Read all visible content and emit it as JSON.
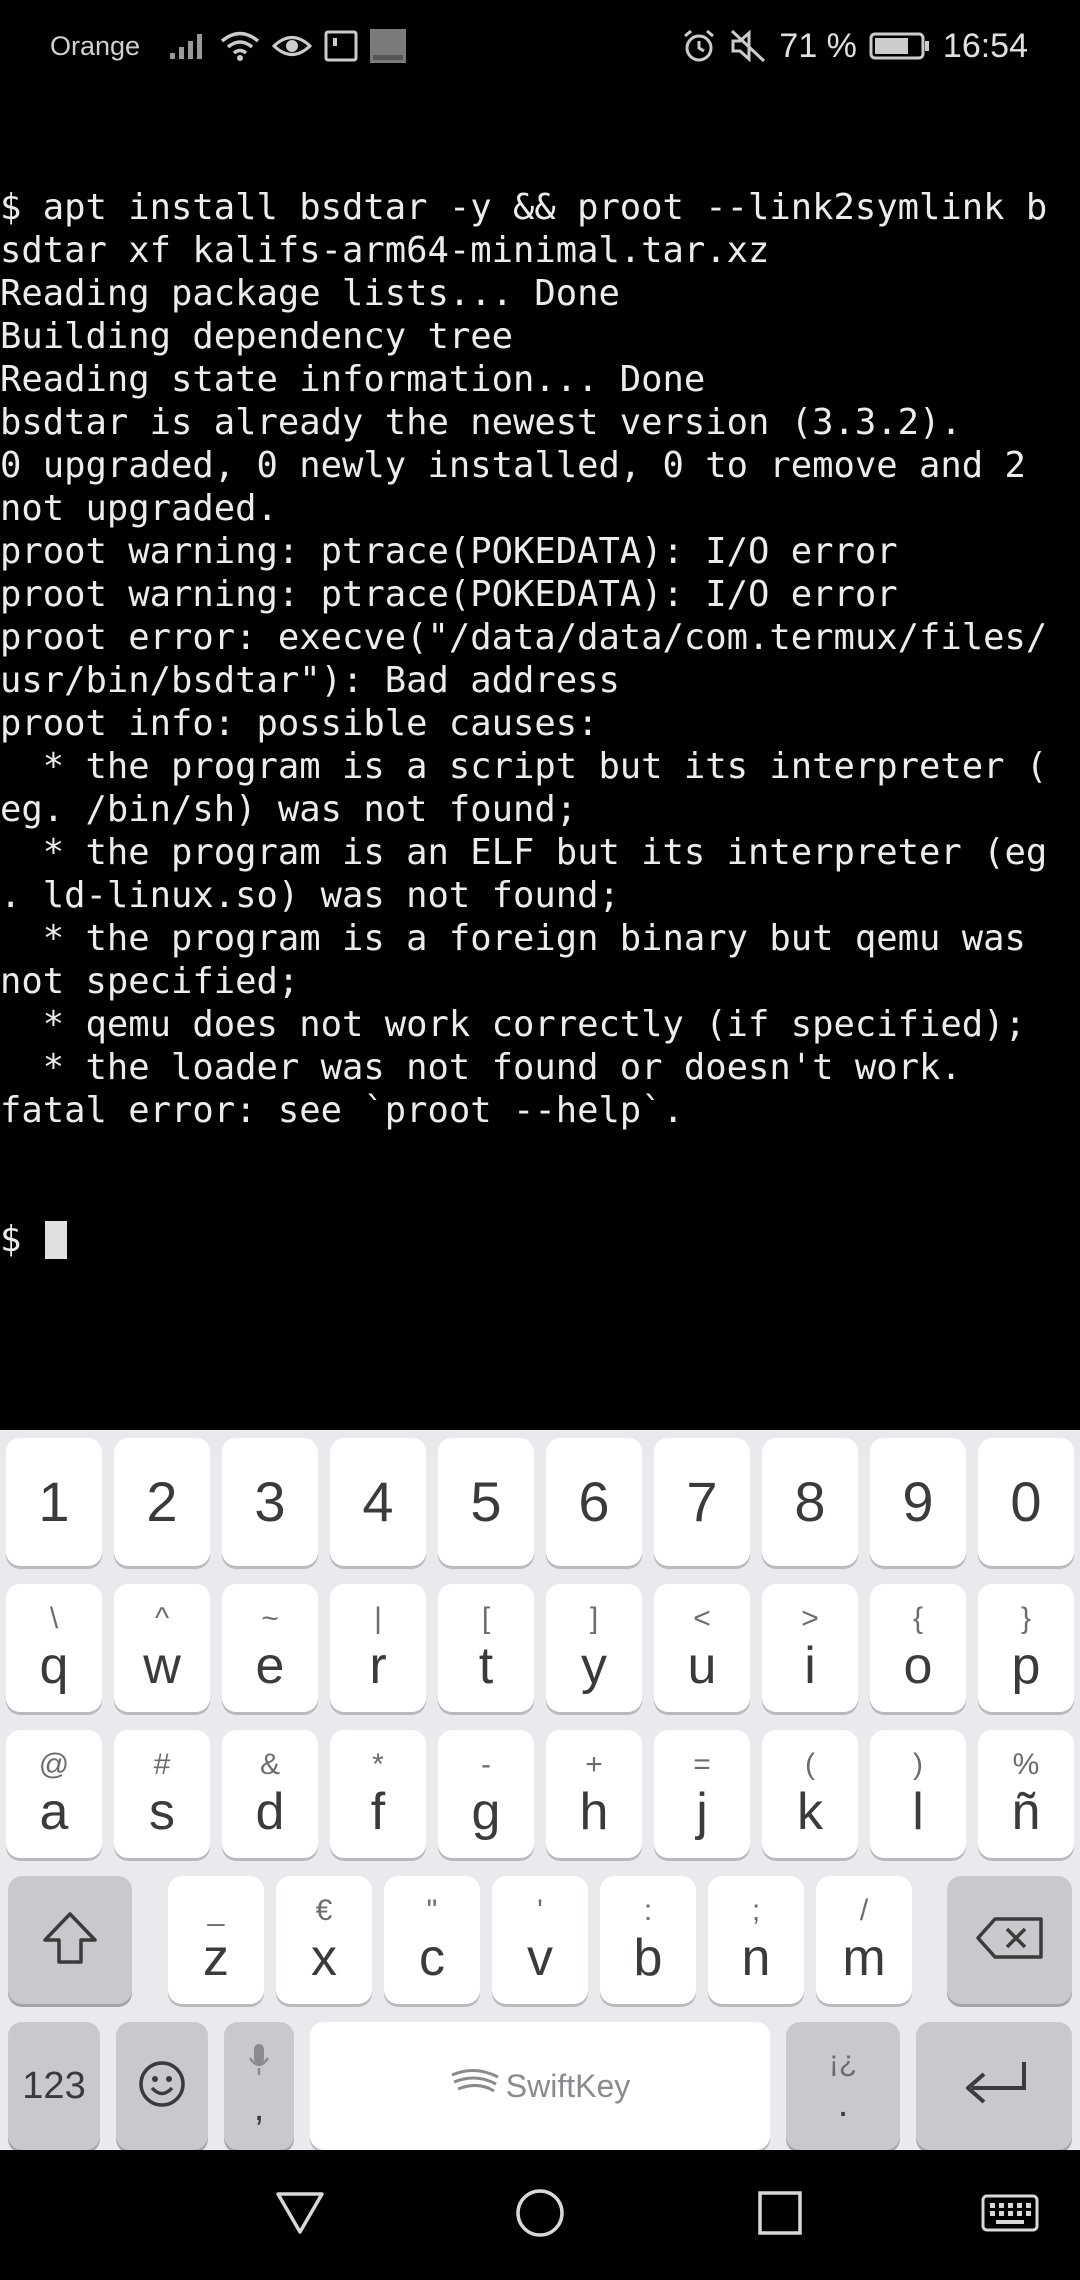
{
  "status_bar": {
    "carrier": "Orange",
    "battery": "71 %",
    "time": "16:54",
    "icons": [
      "signal-icon",
      "wifi-icon",
      "eye-icon",
      "notification-icon",
      "orange-app-icon",
      "alarm-icon",
      "mute-icon",
      "battery-icon"
    ]
  },
  "terminal": {
    "lines": [
      "$ apt install bsdtar -y && proot --link2symlink b",
      "sdtar xf kalifs-arm64-minimal.tar.xz",
      "Reading package lists... Done",
      "Building dependency tree",
      "Reading state information... Done",
      "bsdtar is already the newest version (3.3.2).",
      "0 upgraded, 0 newly installed, 0 to remove and 2",
      "not upgraded.",
      "proot warning: ptrace(POKEDATA): I/O error",
      "proot warning: ptrace(POKEDATA): I/O error",
      "proot error: execve(\"/data/data/com.termux/files/",
      "usr/bin/bsdtar\"): Bad address",
      "proot info: possible causes:",
      "  * the program is a script but its interpreter (",
      "eg. /bin/sh) was not found;",
      "  * the program is an ELF but its interpreter (eg",
      ". ld-linux.so) was not found;",
      "  * the program is a foreign binary but qemu was",
      "not specified;",
      "  * qemu does not work correctly (if specified);",
      "  * the loader was not found or doesn't work.",
      "fatal error: see `proot --help`."
    ],
    "prompt": "$ "
  },
  "keyboard": {
    "number_row": [
      "1",
      "2",
      "3",
      "4",
      "5",
      "6",
      "7",
      "8",
      "9",
      "0"
    ],
    "row1": [
      {
        "main": "q",
        "hint": "\\"
      },
      {
        "main": "w",
        "hint": "^"
      },
      {
        "main": "e",
        "hint": "~"
      },
      {
        "main": "r",
        "hint": "|"
      },
      {
        "main": "t",
        "hint": "["
      },
      {
        "main": "y",
        "hint": "]"
      },
      {
        "main": "u",
        "hint": "<"
      },
      {
        "main": "i",
        "hint": ">"
      },
      {
        "main": "o",
        "hint": "{"
      },
      {
        "main": "p",
        "hint": "}"
      }
    ],
    "row2": [
      {
        "main": "a",
        "hint": "@"
      },
      {
        "main": "s",
        "hint": "#"
      },
      {
        "main": "d",
        "hint": "&"
      },
      {
        "main": "f",
        "hint": "*"
      },
      {
        "main": "g",
        "hint": "-"
      },
      {
        "main": "h",
        "hint": "+"
      },
      {
        "main": "j",
        "hint": "="
      },
      {
        "main": "k",
        "hint": "("
      },
      {
        "main": "l",
        "hint": ")"
      },
      {
        "main": "ñ",
        "hint": "%"
      }
    ],
    "row3": [
      {
        "main": "z",
        "hint": "_"
      },
      {
        "main": "x",
        "hint": "€"
      },
      {
        "main": "c",
        "hint": "\""
      },
      {
        "main": "v",
        "hint": "'"
      },
      {
        "main": "b",
        "hint": ":"
      },
      {
        "main": "n",
        "hint": ";"
      },
      {
        "main": "m",
        "hint": "/"
      }
    ],
    "symbols_label": "123",
    "comma": ",",
    "space_brand": "SwiftKey",
    "period": ".",
    "period_hint": "¡¿"
  }
}
